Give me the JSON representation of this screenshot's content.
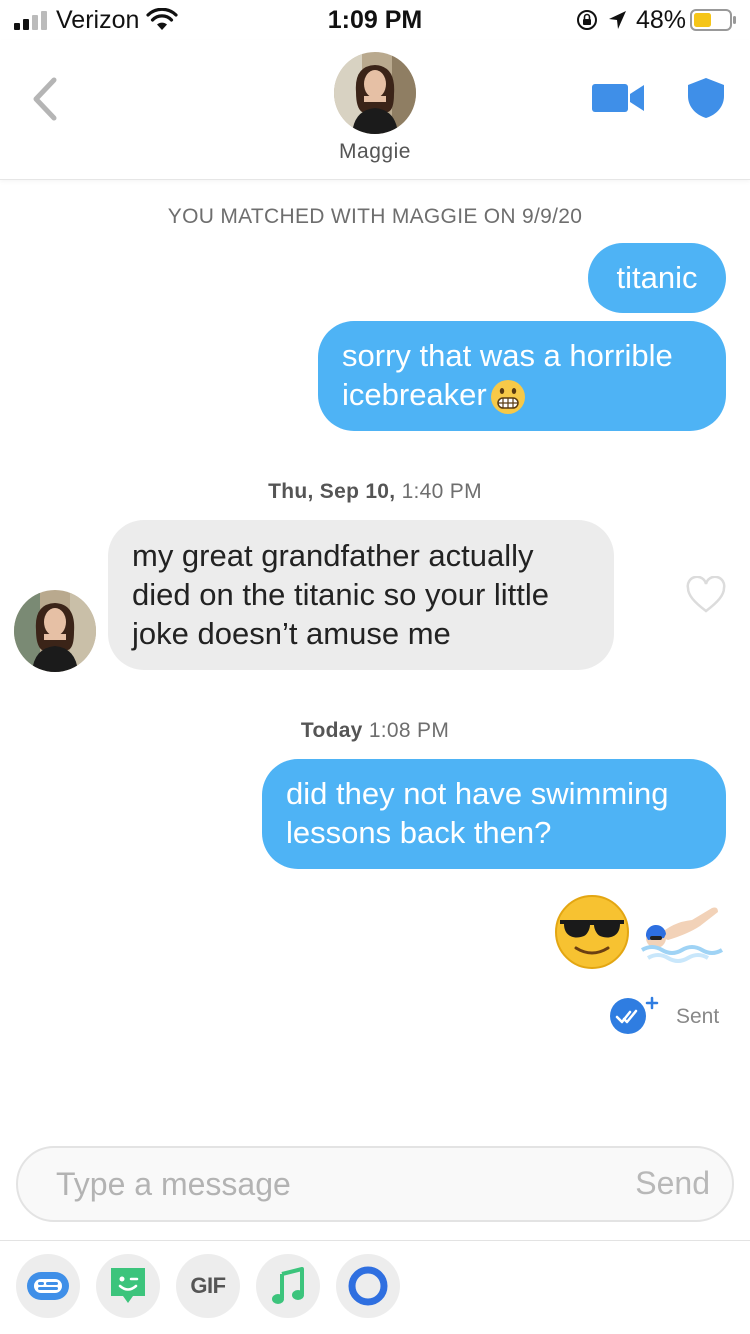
{
  "status_bar": {
    "carrier": "Verizon",
    "time": "1:09 PM",
    "battery": "48%"
  },
  "header": {
    "match_name": "Maggie"
  },
  "conversation": {
    "match_notice": "YOU MATCHED WITH MAGGIE ON 9/9/20",
    "messages_1": [
      "titanic",
      "sorry that was a horrible icebreaker"
    ],
    "timestamp_2_day": "Thu, Sep 10,",
    "timestamp_2_time": "1:40 PM",
    "received_message": "my great grandfather actually died on the titanic so your little joke doesn’t amuse me",
    "timestamp_3_day": "Today",
    "timestamp_3_time": "1:08 PM",
    "reply_message": "did they not have swimming lessons back then?",
    "emoji_names": [
      "smiling-face-with-sunglasses",
      "person-swimming"
    ],
    "delivery_status": "Sent"
  },
  "composer": {
    "placeholder": "Type a message",
    "send_label": "Send"
  },
  "toolbar": {
    "gif_label": "GIF",
    "icons": [
      "sticker-icon",
      "bitmoji-icon",
      "gif-icon",
      "music-icon",
      "loop-icon"
    ]
  },
  "colors": {
    "sent_bubble": "#4eb3f5",
    "received_bubble": "#ececec",
    "accent_blue": "#3f8fe8"
  }
}
